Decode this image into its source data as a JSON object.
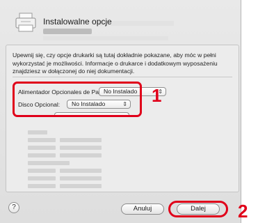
{
  "dialog": {
    "title": "Instalowalne opcje",
    "description": "Upewnij się, czy opcje drukarki są tutaj dokładnie pokazane, aby móc w pełni wykorzystać je możliwości. Informacje o drukarce i dodatkowym wyposażeniu znajdziesz w dołączonej do niej dokumentacji."
  },
  "options": [
    {
      "label": "Alimentador Opcionales de Papel:",
      "value": "No Instalado"
    },
    {
      "label": "Disco Opcional:",
      "value": "No Instalado"
    }
  ],
  "buttons": {
    "help": "?",
    "cancel": "Anuluj",
    "next": "Dalej"
  },
  "callouts": {
    "step1": "1",
    "step2": "2"
  },
  "colors": {
    "callout": "#e0001a"
  }
}
